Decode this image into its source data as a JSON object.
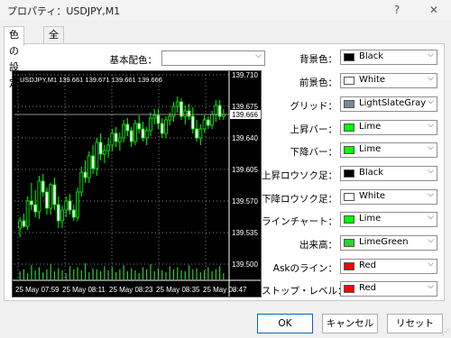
{
  "window": {
    "title": "プロパティ：USDJPY,M1",
    "help": "?",
    "close": "✕"
  },
  "tabs": [
    {
      "label": "色の設定"
    },
    {
      "label": "全般"
    }
  ],
  "scheme": {
    "label": "基本配色：",
    "value": ""
  },
  "settings": [
    {
      "label": "背景色：",
      "value": "Black",
      "color": "#000000"
    },
    {
      "label": "前景色：",
      "value": "White",
      "color": "#ffffff"
    },
    {
      "label": "グリッド：",
      "value": "LightSlateGray",
      "color": "#778899"
    },
    {
      "label": "上昇バー：",
      "value": "Lime",
      "color": "#00ff00"
    },
    {
      "label": "下降バー：",
      "value": "Lime",
      "color": "#00ff00"
    },
    {
      "label": "上昇ロウソク足：",
      "value": "Black",
      "color": "#000000"
    },
    {
      "label": "下降ロウソク足：",
      "value": "White",
      "color": "#ffffff"
    },
    {
      "label": "ラインチャート：",
      "value": "Lime",
      "color": "#00ff00"
    },
    {
      "label": "出来高：",
      "value": "LimeGreen",
      "color": "#32cd32"
    },
    {
      "label": "Askのライン：",
      "value": "Red",
      "color": "#ff0000"
    },
    {
      "label": "ストップ・レベル：",
      "value": "Red",
      "color": "#ff0000"
    }
  ],
  "preview": {
    "header": "USDJPY,M1  139.661  139.671  139.661  139.666",
    "price_ticks": [
      "139.710",
      "139.675",
      "139.640",
      "139.605",
      "139.570",
      "139.535",
      "139.500"
    ],
    "current_price": "139.666",
    "time_labels": [
      "25 May 07:59",
      "25 May 08:11",
      "25 May 08:23",
      "25 May 08:35",
      "25 May 08:47"
    ],
    "candles": [
      [
        139.54,
        139.552,
        139.53,
        139.548
      ],
      [
        139.548,
        139.556,
        139.54,
        139.542
      ],
      [
        139.542,
        139.575,
        139.538,
        139.57
      ],
      [
        139.57,
        139.59,
        139.56,
        139.566
      ],
      [
        139.566,
        139.582,
        139.552,
        139.558
      ],
      [
        139.558,
        139.598,
        139.55,
        139.592
      ],
      [
        139.592,
        139.6,
        139.575,
        139.58
      ],
      [
        139.58,
        139.585,
        139.555,
        139.562
      ],
      [
        139.562,
        139.59,
        139.555,
        139.588
      ],
      [
        139.588,
        139.596,
        139.56,
        139.566
      ],
      [
        139.566,
        139.575,
        139.54,
        139.548
      ],
      [
        139.548,
        139.565,
        139.54,
        139.56
      ],
      [
        139.56,
        139.575,
        139.552,
        139.57
      ],
      [
        139.57,
        139.578,
        139.555,
        139.56
      ],
      [
        139.56,
        139.566,
        139.548,
        139.552
      ],
      [
        139.552,
        139.585,
        139.548,
        139.58
      ],
      [
        139.58,
        139.608,
        139.575,
        139.602
      ],
      [
        139.602,
        139.615,
        139.59,
        139.596
      ],
      [
        139.596,
        139.625,
        139.59,
        139.62
      ],
      [
        139.62,
        139.632,
        139.6,
        139.606
      ],
      [
        139.606,
        139.64,
        139.598,
        139.635
      ],
      [
        139.635,
        139.645,
        139.615,
        139.622
      ],
      [
        139.622,
        139.632,
        139.612,
        139.626
      ],
      [
        139.626,
        139.64,
        139.618,
        139.632
      ],
      [
        139.632,
        139.65,
        139.625,
        139.645
      ],
      [
        139.645,
        139.652,
        139.63,
        139.636
      ],
      [
        139.636,
        139.646,
        139.626,
        139.64
      ],
      [
        139.64,
        139.66,
        139.635,
        139.655
      ],
      [
        139.655,
        139.662,
        139.642,
        139.648
      ],
      [
        139.648,
        139.652,
        139.63,
        139.636
      ],
      [
        139.636,
        139.66,
        139.632,
        139.656
      ],
      [
        139.656,
        139.665,
        139.645,
        139.65
      ],
      [
        139.65,
        139.658,
        139.636,
        139.64
      ],
      [
        139.64,
        139.652,
        139.632,
        139.648
      ],
      [
        139.648,
        139.668,
        139.642,
        139.662
      ],
      [
        139.662,
        139.672,
        139.655,
        139.665
      ],
      [
        139.665,
        139.672,
        139.65,
        139.656
      ],
      [
        139.656,
        139.662,
        139.64,
        139.645
      ],
      [
        139.645,
        139.664,
        139.64,
        139.66
      ],
      [
        139.66,
        139.668,
        139.654,
        139.664
      ],
      [
        139.664,
        139.68,
        139.658,
        139.675
      ],
      [
        139.675,
        139.686,
        139.668,
        139.68
      ],
      [
        139.68,
        139.684,
        139.66,
        139.664
      ],
      [
        139.664,
        139.676,
        139.655,
        139.67
      ],
      [
        139.67,
        139.678,
        139.66,
        139.664
      ],
      [
        139.664,
        139.674,
        139.645,
        139.65
      ],
      [
        139.65,
        139.66,
        139.636,
        139.64
      ],
      [
        139.64,
        139.655,
        139.632,
        139.65
      ],
      [
        139.65,
        139.665,
        139.646,
        139.66
      ],
      [
        139.66,
        139.664,
        139.65,
        139.654
      ],
      [
        139.654,
        139.67,
        139.65,
        139.666
      ],
      [
        139.666,
        139.682,
        139.658,
        139.676
      ],
      [
        139.676,
        139.682,
        139.66,
        139.664
      ],
      [
        139.664,
        139.672,
        139.66,
        139.666
      ]
    ],
    "volumes": [
      8,
      10,
      6,
      14,
      9,
      12,
      7,
      10,
      15,
      8,
      11,
      9,
      6,
      13,
      10,
      12,
      9,
      16,
      7,
      11,
      10,
      8,
      13,
      9,
      12,
      7,
      10,
      14,
      8,
      11,
      9,
      6,
      12,
      10,
      15,
      8,
      11,
      9,
      7,
      13,
      10,
      12,
      9,
      8,
      14,
      10,
      11,
      7,
      9,
      12,
      8,
      10,
      13,
      6
    ]
  },
  "buttons": {
    "ok": "OK",
    "cancel": "キャンセル",
    "reset": "リセット"
  }
}
